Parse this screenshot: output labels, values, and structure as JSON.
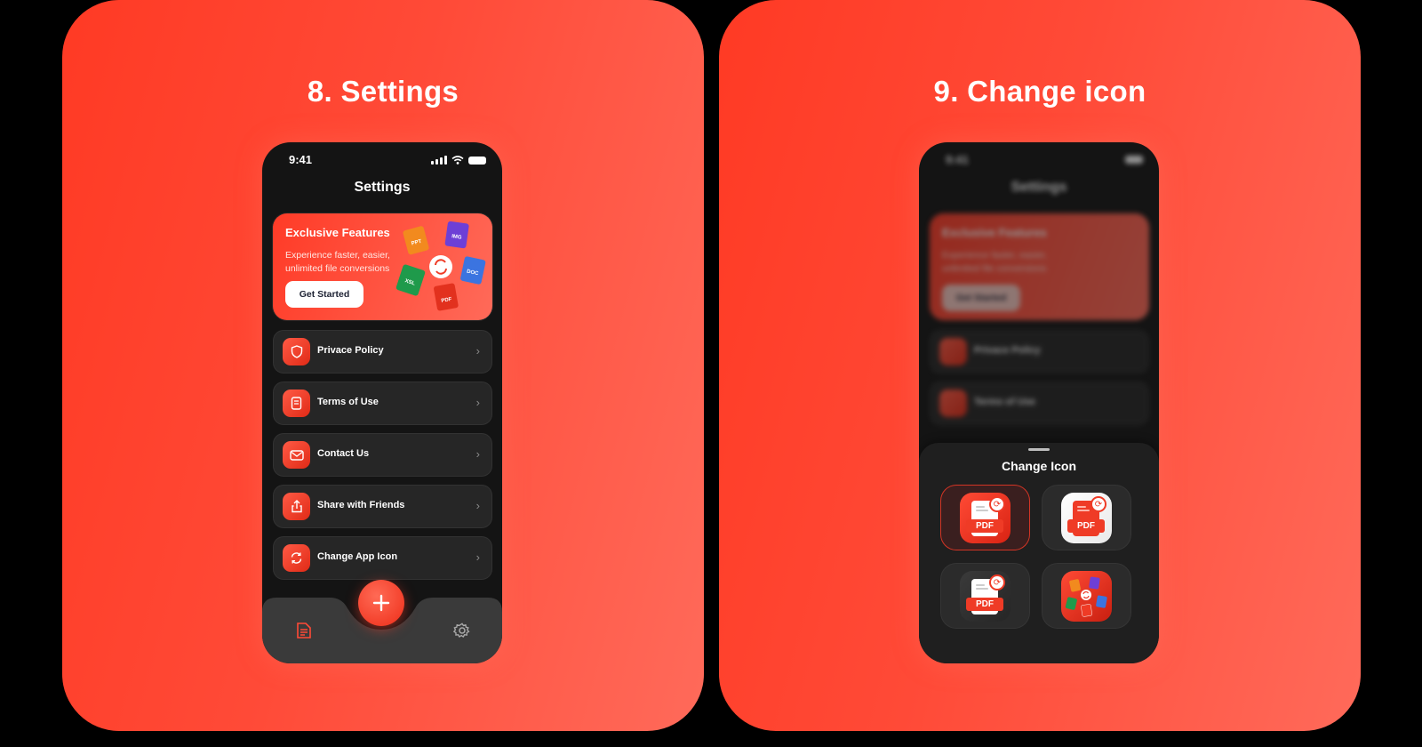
{
  "colors": {
    "accent": "#ff3b27",
    "background": "#000000",
    "phone": "#141414",
    "card": "#262626"
  },
  "left": {
    "title": "8. Settings",
    "status": {
      "time": "9:41"
    },
    "screen_title": "Settings",
    "promo": {
      "title": "Exclusive Features",
      "subtitle": "Experience faster, easier, unlimited file conversions",
      "button": "Get Started",
      "file_badges": [
        "PPT",
        "IMG",
        "XSL",
        "DOC",
        "PDF"
      ]
    },
    "menu": [
      {
        "label": "Privace Policy",
        "icon": "shield-icon"
      },
      {
        "label": "Terms of Use",
        "icon": "document-icon"
      },
      {
        "label": "Contact Us",
        "icon": "mail-icon"
      },
      {
        "label": "Share with Friends",
        "icon": "share-icon"
      },
      {
        "label": "Change App Icon",
        "icon": "refresh-icon"
      }
    ],
    "tabbar": {
      "left": "file-list-icon",
      "fab": "plus-icon",
      "right": "gear-icon"
    }
  },
  "right": {
    "title": "9. Change icon",
    "status": {
      "time": "9:41"
    },
    "screen_title": "Settings",
    "promo": {
      "title": "Exclusive Features",
      "subtitle": "Experience faster, easier, unlimited file conversions",
      "button": "Get Started"
    },
    "menu": [
      {
        "label": "Privace Policy"
      },
      {
        "label": "Terms of Use"
      }
    ],
    "sheet": {
      "title": "Change Icon",
      "options": [
        {
          "label": "PDF",
          "style": "red",
          "selected": true
        },
        {
          "label": "PDF",
          "style": "white",
          "selected": false
        },
        {
          "label": "PDF",
          "style": "dark",
          "selected": false
        },
        {
          "label": "",
          "style": "files",
          "selected": false
        }
      ]
    }
  }
}
